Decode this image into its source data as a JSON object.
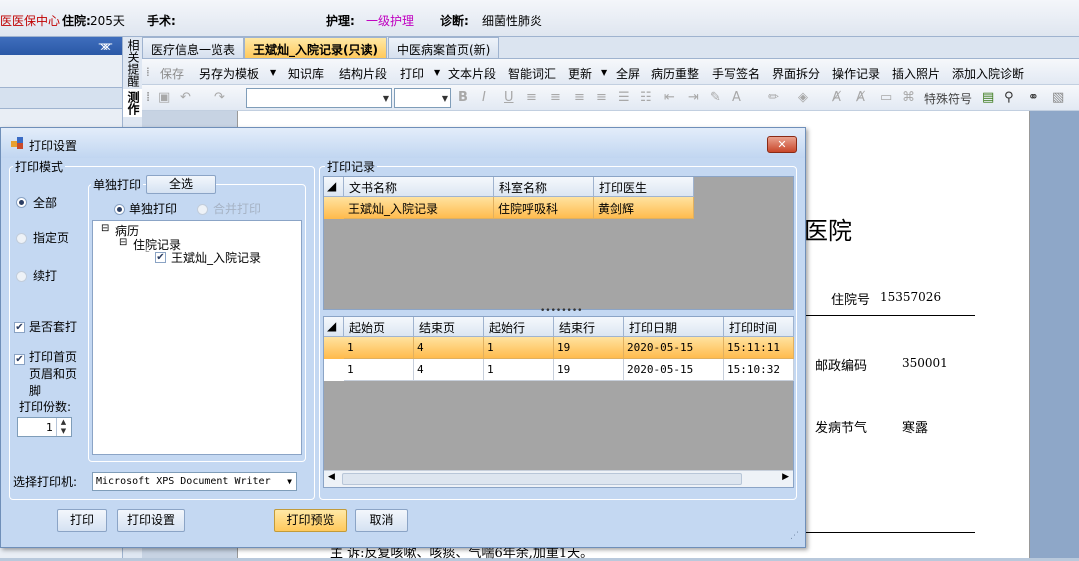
{
  "topbar": {
    "insurance": "医医保中心",
    "stay_label": "住院:",
    "stay_value": "205天",
    "surgery_label": "手术:",
    "nursing_label": "护理:",
    "nursing_value": "一级护理",
    "diagnosis_label": "诊断:",
    "diagnosis_value": "细菌性肺炎"
  },
  "vertical_tabs": [
    "相关提醒",
    "测作"
  ],
  "tabs": [
    "医疗信息一览表",
    "王斌灿_入院记录(只读)",
    "中医病案首页(新)"
  ],
  "toolbar": [
    "保存",
    "另存为模板",
    "知识库",
    "结构片段",
    "打印",
    "文本片段",
    "智能词汇",
    "更新",
    "全屏",
    "病历重整",
    "手写签名",
    "界面拆分",
    "操作记录",
    "插入照片",
    "添加入院诊断"
  ],
  "toolbar2": {
    "special_char": "特殊符号"
  },
  "document": {
    "hospital_title": "医院",
    "admission_no_label": "住院号",
    "admission_no": "15357026",
    "postal_label": "邮政编码",
    "postal_code": "350001",
    "solar_term_label": "发病节气",
    "solar_term": "寒露",
    "complaint_line": "主  诉:反复咳嗽、咳痰、气喘6年余,加重1天。"
  },
  "dialog": {
    "title": "打印设置",
    "close_label": "✕",
    "mode_group": "打印模式",
    "mode_options": [
      "全部",
      "指定页",
      "续打"
    ],
    "check_set": "是否套打",
    "check_header": "打印首页页眉和页脚",
    "copies_label": "打印份数:",
    "copies_value": "1",
    "printer_label": "选择打印机:",
    "printer_value": "Microsoft XPS Document Writer",
    "single_group": "单独打印",
    "select_all": "全选",
    "print_single": "单独打印",
    "print_merge": "合并打印",
    "tree": [
      "病历",
      "住院记录",
      "王斌灿_入院记录"
    ],
    "records_group": "打印记录",
    "records_headers": [
      "文书名称",
      "科室名称",
      "打印医生"
    ],
    "records_rows": [
      [
        "王斌灿_入院记录",
        "住院呼吸科",
        "黄剑辉"
      ]
    ],
    "detail_headers": [
      "起始页",
      "结束页",
      "起始行",
      "结束行",
      "打印日期",
      "打印时间"
    ],
    "detail_rows": [
      [
        "1",
        "4",
        "1",
        "19",
        "2020-05-15",
        "15:11:11"
      ],
      [
        "1",
        "4",
        "1",
        "19",
        "2020-05-15",
        "15:10:32"
      ]
    ],
    "buttons": [
      "打印",
      "打印设置",
      "打印预览",
      "取消"
    ]
  },
  "colors": {
    "accent_selected": "#ffc95c",
    "title_red": "#c00000",
    "nursing_magenta": "#c000c0"
  }
}
